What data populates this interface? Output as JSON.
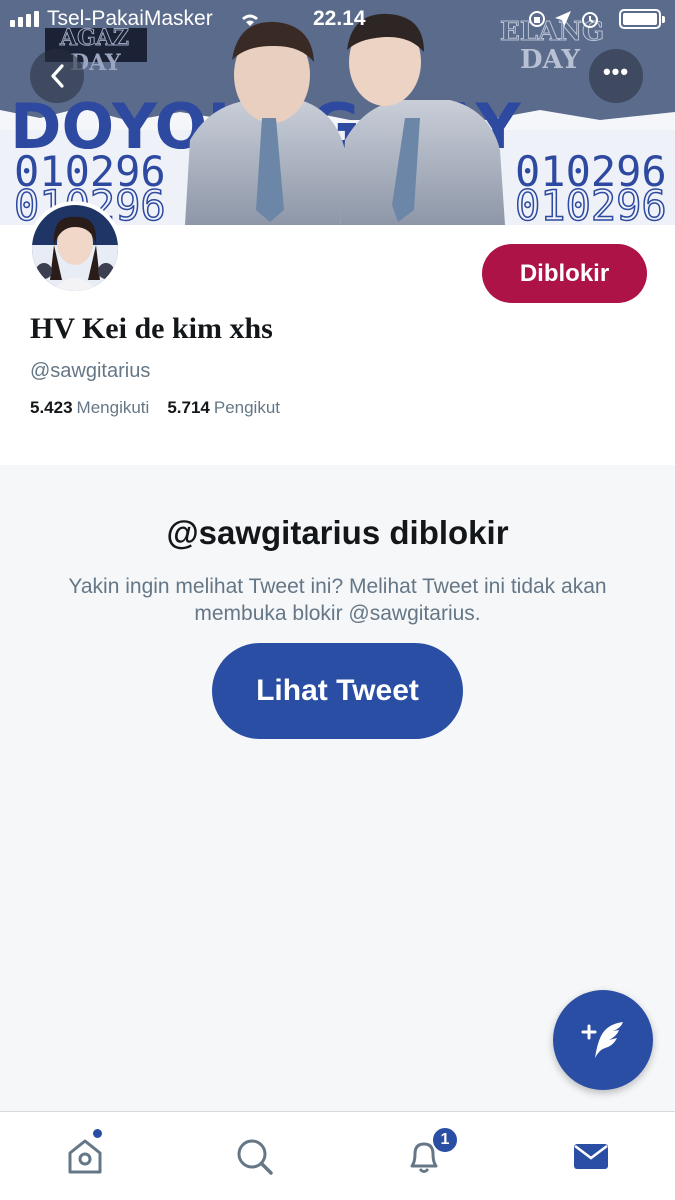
{
  "status_bar": {
    "carrier": "Tsel-PakaiMasker",
    "time": "22.14"
  },
  "banner": {
    "top_left_text": [
      "AGAZ",
      "DAY"
    ],
    "top_right_text": [
      "ELANG",
      "DAY"
    ],
    "headline": "DOYOUNG DAY",
    "date_code": "010296"
  },
  "profile": {
    "display_name": "HV Kei de kim xhs",
    "handle": "@sawgitarius",
    "following_count": "5.423",
    "following_label": "Mengikuti",
    "followers_count": "5.714",
    "followers_label": "Pengikut",
    "blocked_button_label": "Diblokir"
  },
  "blocked_notice": {
    "title": "@sawgitarius diblokir",
    "description": "Yakin ingin melihat Tweet ini? Melihat Tweet ini tidak akan membuka blokir @sawgitarius.",
    "view_button_label": "Lihat Tweet"
  },
  "tabbar": {
    "items": [
      {
        "name": "home",
        "icon": "home-icon"
      },
      {
        "name": "search",
        "icon": "search-icon"
      },
      {
        "name": "notifications",
        "icon": "bell-icon"
      },
      {
        "name": "messages",
        "icon": "mail-icon"
      }
    ],
    "notification_badge": "1"
  },
  "colors": {
    "primary": "#2a4ea3",
    "blocked": "#ad1346",
    "text": "#14171a",
    "muted": "#657786"
  }
}
